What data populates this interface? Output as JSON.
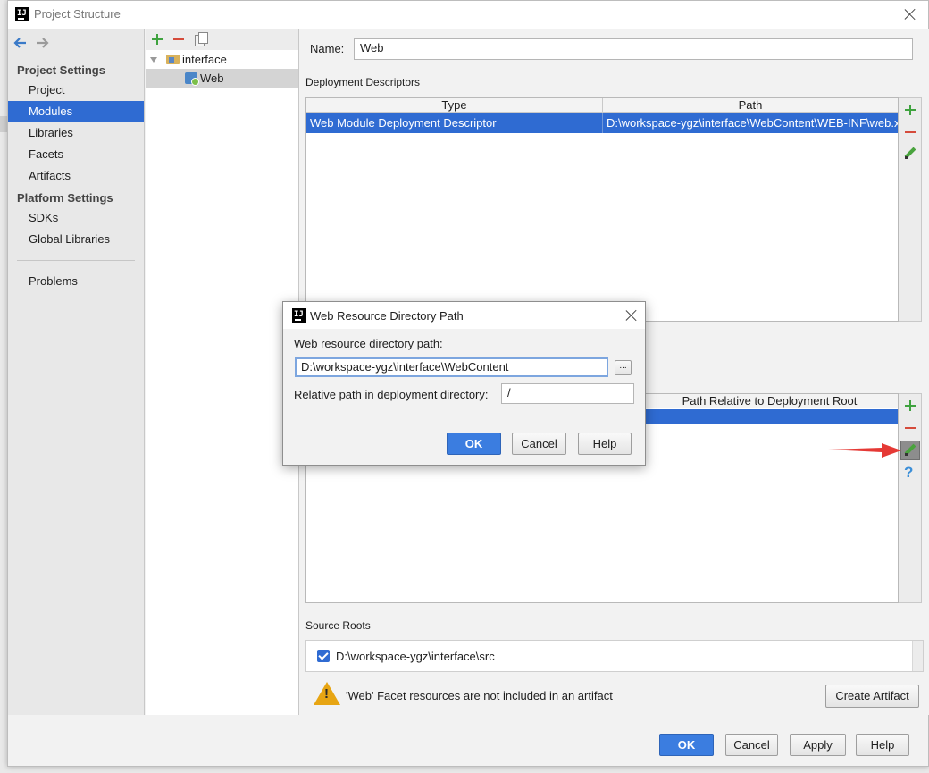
{
  "window": {
    "title": "Project Structure"
  },
  "nav": {
    "back_icon": "arrow-left-icon",
    "forward_icon": "arrow-right-icon",
    "sections": [
      {
        "heading": "Project Settings",
        "items": [
          "Project",
          "Modules",
          "Libraries",
          "Facets",
          "Artifacts"
        ]
      },
      {
        "heading": "Platform Settings",
        "items": [
          "SDKs",
          "Global Libraries"
        ]
      }
    ],
    "problems": "Problems",
    "selected": "Modules"
  },
  "tree": {
    "root": "interface",
    "child": "Web"
  },
  "facet": {
    "name_label": "Name:",
    "name_value": "Web",
    "deployment_descriptors_label": "Deployment Descriptors",
    "dd_columns": [
      "Type",
      "Path"
    ],
    "dd_rows": [
      {
        "type": "Web Module Deployment Descriptor",
        "path": "D:\\workspace-ygz\\interface\\WebContent\\WEB-INF\\web.xml"
      }
    ],
    "web_resource_column": "Path Relative to Deployment Root",
    "source_roots_label": "Source Roots",
    "source_root_path": "D:\\workspace-ygz\\interface\\src",
    "warning_text": "'Web' Facet resources are not included in an artifact",
    "create_artifact_label": "Create Artifact"
  },
  "buttons": {
    "ok": "OK",
    "cancel": "Cancel",
    "apply": "Apply",
    "help": "Help"
  },
  "dialog": {
    "title": "Web Resource Directory Path",
    "dir_label": "Web resource directory path:",
    "dir_value": "D:\\workspace-ygz\\interface\\WebContent",
    "browse": "...",
    "relative_label": "Relative path in deployment directory:",
    "relative_value": "/",
    "ok": "OK",
    "cancel": "Cancel",
    "help": "Help"
  },
  "colors": {
    "selection": "#2f6bd2",
    "accent_green": "#3fa33f",
    "accent_red": "#d54b3b",
    "annotation_arrow": "#e53935"
  }
}
